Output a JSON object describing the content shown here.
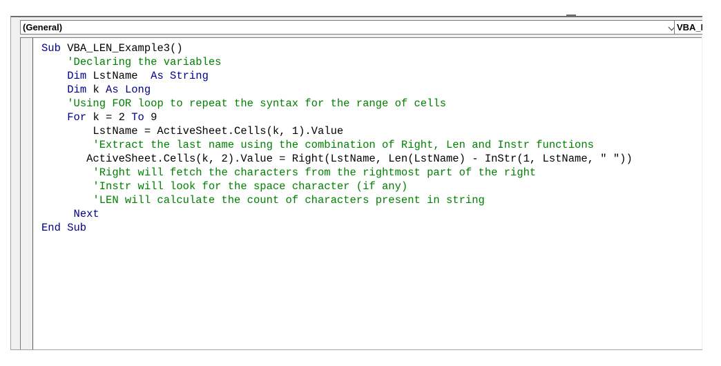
{
  "toolbar": {
    "object_combo": "(General)",
    "procedure_combo": "VBA_I",
    "icons": {
      "dropdown": "chevron-down-icon"
    }
  },
  "colors": {
    "keyword": "#00008b",
    "comment": "#008000",
    "text": "#000000"
  },
  "code": {
    "lines": [
      {
        "indent": "",
        "parts": [
          {
            "t": "kw",
            "v": "Sub "
          },
          {
            "t": "tx",
            "v": "VBA_LEN_Example3()"
          }
        ]
      },
      {
        "indent": "    ",
        "parts": [
          {
            "t": "cm",
            "v": "'Declaring the variables"
          }
        ]
      },
      {
        "indent": "    ",
        "parts": [
          {
            "t": "kw",
            "v": "Dim "
          },
          {
            "t": "tx",
            "v": "LstName  "
          },
          {
            "t": "kw",
            "v": "As String"
          }
        ]
      },
      {
        "indent": "    ",
        "parts": [
          {
            "t": "kw",
            "v": "Dim "
          },
          {
            "t": "tx",
            "v": "k "
          },
          {
            "t": "kw",
            "v": "As Long"
          }
        ]
      },
      {
        "indent": "    ",
        "parts": [
          {
            "t": "cm",
            "v": "'Using FOR loop to repeat the syntax for the range of cells"
          }
        ]
      },
      {
        "indent": "    ",
        "parts": [
          {
            "t": "kw",
            "v": "For "
          },
          {
            "t": "tx",
            "v": "k = 2 "
          },
          {
            "t": "kw",
            "v": "To "
          },
          {
            "t": "tx",
            "v": "9"
          }
        ]
      },
      {
        "indent": "        ",
        "parts": [
          {
            "t": "tx",
            "v": "LstName = ActiveSheet.Cells(k, 1).Value"
          }
        ]
      },
      {
        "indent": "        ",
        "parts": [
          {
            "t": "cm",
            "v": "'Extract the last name using the combination of Right, Len and Instr functions"
          }
        ]
      },
      {
        "indent": "       ",
        "parts": [
          {
            "t": "tx",
            "v": "ActiveSheet.Cells(k, 2).Value = Right(LstName, Len(LstName) - InStr(1, LstName, \" \"))"
          }
        ]
      },
      {
        "indent": "        ",
        "parts": [
          {
            "t": "cm",
            "v": "'Right will fetch the characters from the rightmost part of the right"
          }
        ]
      },
      {
        "indent": "        ",
        "parts": [
          {
            "t": "cm",
            "v": "'Instr will look for the space character (if any)"
          }
        ]
      },
      {
        "indent": "        ",
        "parts": [
          {
            "t": "cm",
            "v": "'LEN will calculate the count of characters present in string"
          }
        ]
      },
      {
        "indent": "     ",
        "parts": [
          {
            "t": "kw",
            "v": "Next"
          }
        ]
      },
      {
        "indent": "",
        "parts": [
          {
            "t": "kw",
            "v": "End Sub"
          }
        ]
      }
    ]
  }
}
